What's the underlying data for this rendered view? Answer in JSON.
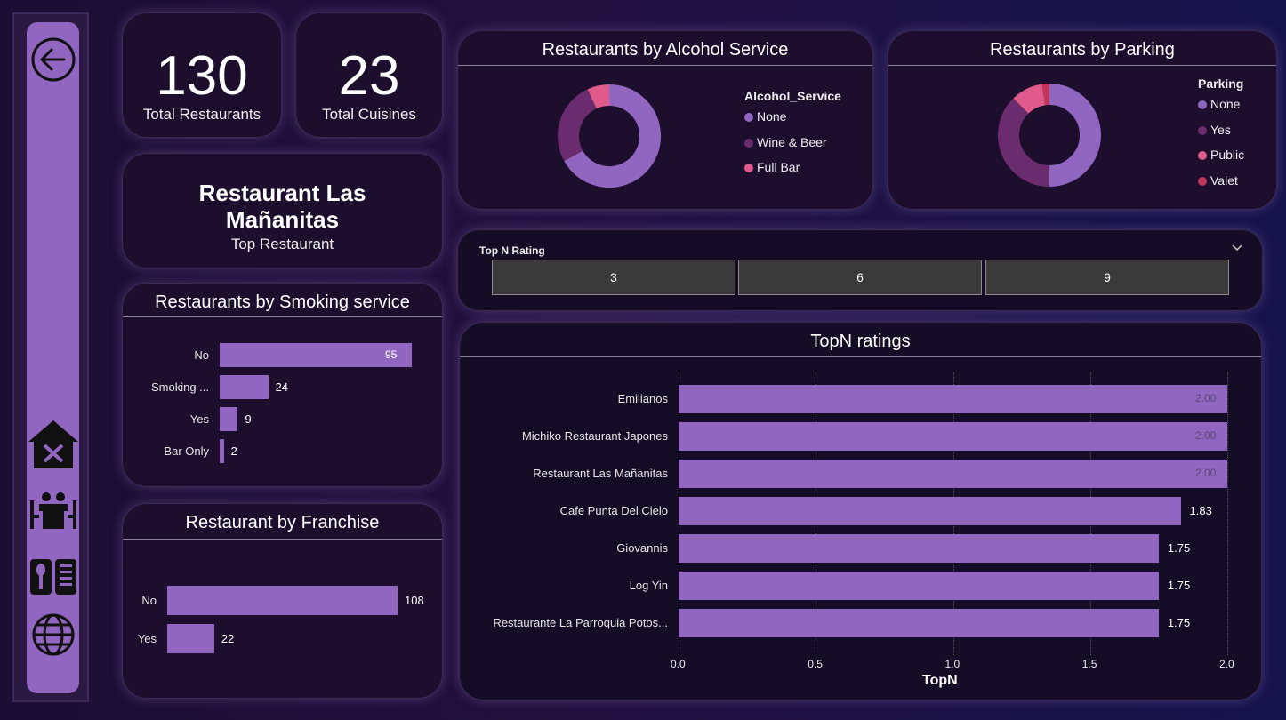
{
  "kpis": {
    "restaurants_value": "130",
    "restaurants_label": "Total Restaurants",
    "cuisines_value": "23",
    "cuisines_label": "Total Cuisines"
  },
  "top_restaurant": {
    "name_line1": "Restaurant Las",
    "name_line2": "Mañanitas",
    "label": "Top Restaurant"
  },
  "nav": {
    "icons": [
      "back-arrow-icon",
      "restaurant-home-icon",
      "dining-table-icon",
      "menu-book-icon",
      "globe-icon"
    ]
  },
  "colors": {
    "accent": "#9166c0",
    "dark_purple": "#6a2c6f",
    "pink": "#e05a8c",
    "red": "#c2345a"
  },
  "alcohol": {
    "title": "Restaurants by Alcohol Service",
    "legend_title": "Alcohol_Service",
    "items": [
      {
        "label": "None",
        "value": 87,
        "color": "#9166c0"
      },
      {
        "label": "Wine & Beer",
        "value": 34,
        "color": "#6a2c6f"
      },
      {
        "label": "Full Bar",
        "value": 9,
        "color": "#e05a8c"
      }
    ]
  },
  "parking": {
    "title": "Restaurants by Parking",
    "legend_title": "Parking",
    "items": [
      {
        "label": "None",
        "value": 65,
        "color": "#9166c0"
      },
      {
        "label": "Yes",
        "value": 49,
        "color": "#6a2c6f"
      },
      {
        "label": "Public",
        "value": 13,
        "color": "#e05a8c"
      },
      {
        "label": "Valet",
        "value": 3,
        "color": "#c2345a"
      }
    ]
  },
  "slicer": {
    "title": "Top N Rating",
    "options": [
      "3",
      "6",
      "9"
    ]
  },
  "smoking": {
    "title": "Restaurants by Smoking service",
    "categories": [
      "No",
      "Smoking ...",
      "Yes",
      "Bar Only"
    ],
    "values": [
      95,
      24,
      9,
      2
    ]
  },
  "franchise": {
    "title": "Restaurant by Franchise",
    "categories": [
      "No",
      "Yes"
    ],
    "values": [
      108,
      22
    ]
  },
  "chart_data": {
    "type": "bar",
    "title": "TopN ratings",
    "xlabel": "TopN",
    "categories": [
      "Emilianos",
      "Michiko Restaurant Japones",
      "Restaurant Las Mañanitas",
      "Cafe Punta Del Cielo",
      "Giovannis",
      "Log Yin",
      "Restaurante La Parroquia Potos..."
    ],
    "values": [
      2.0,
      2.0,
      2.0,
      1.83,
      1.75,
      1.75,
      1.75
    ],
    "value_labels": [
      "2.00",
      "2.00",
      "2.00",
      "1.83",
      "1.75",
      "1.75",
      "1.75"
    ],
    "xlim": [
      0,
      2
    ],
    "xticks": [
      "0.0",
      "0.5",
      "1.0",
      "1.5",
      "2.0"
    ],
    "grid": true
  }
}
